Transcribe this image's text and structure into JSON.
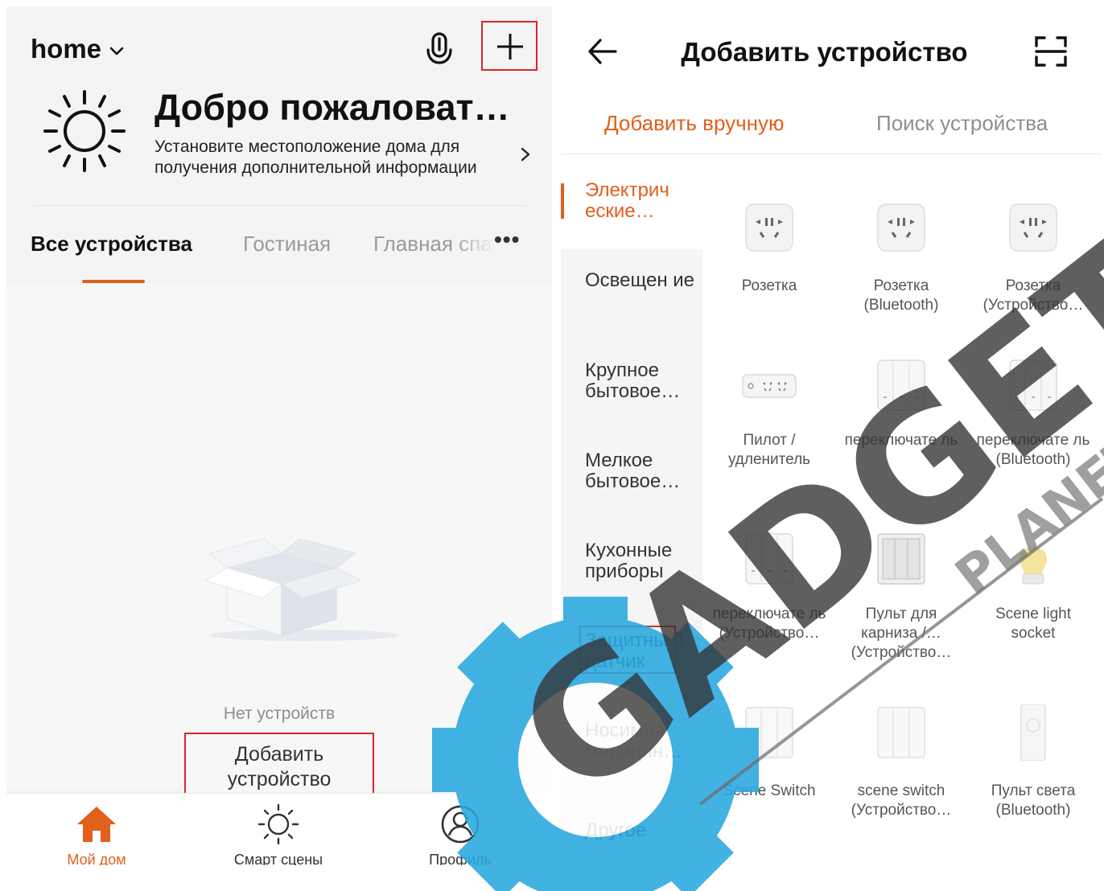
{
  "left": {
    "home": {
      "title": "home"
    },
    "welcome": {
      "title": "Добро пожаловат…",
      "subtitle": "Установите местоположение дома для получения дополнительной информации"
    },
    "rooms": [
      "Все устройства",
      "Гостиная",
      "Главная спальня"
    ],
    "empty_text": "Нет устройств",
    "add_device_button": "Добавить устройство",
    "bottom_nav": [
      {
        "label": "Мой дом",
        "icon": "home-icon",
        "active": true
      },
      {
        "label": "Смарт сцены",
        "icon": "sun-icon",
        "active": false
      },
      {
        "label": "Профиль",
        "icon": "profile-icon",
        "active": false
      }
    ]
  },
  "right": {
    "title": "Добавить устройство",
    "tabs": [
      "Добавить вручную",
      "Поиск устройства"
    ],
    "categories": [
      "Электрич еские…",
      "Освещен ие",
      "Крупное бытовое…",
      "Мелкое бытовое…",
      "Кухонные приборы",
      "Защитны й датчик",
      "Носимая медицин…",
      "Другое"
    ],
    "devices": [
      "Розетка",
      "Розетка (Bluetooth)",
      "Розетка (Устройство…",
      "Пилот / удленитель",
      "переключате ль",
      "переключате ль (Bluetooth)",
      "переключате ль (Устройство…",
      "Пульт для карниза /… (Устройство…",
      "Scene light socket",
      "Scene Switch",
      "scene switch (Устройство…",
      "Пульт света (Bluetooth)"
    ]
  },
  "watermark": {
    "text": "GADGET",
    "subtext": "PLANET"
  },
  "colors": {
    "accent": "#e0601c",
    "highlight": "#d9262c",
    "watermark": "#29a8e0"
  }
}
